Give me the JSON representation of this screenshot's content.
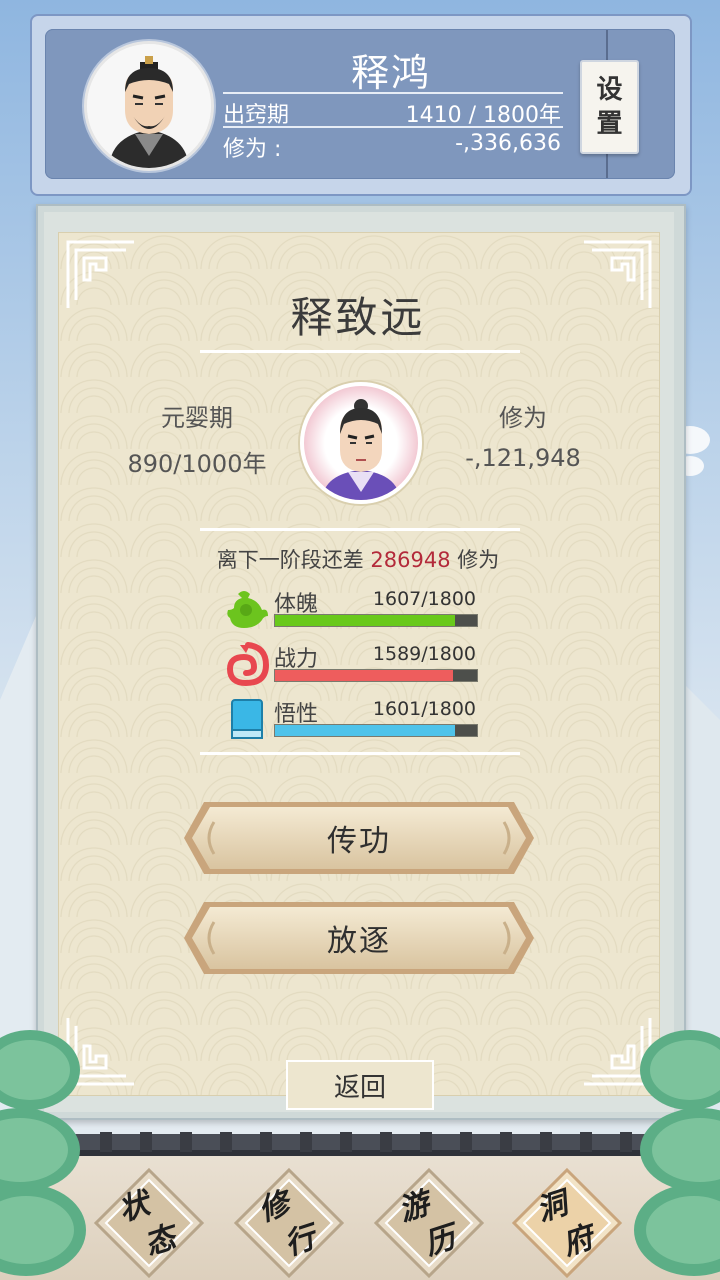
{
  "header": {
    "player_name": "释鸿",
    "realm_label": "出窍期",
    "realm_years": "1410 / 1800年",
    "cultivation_label": "修为 :",
    "cultivation_value": "-,336,636",
    "settings_char_1": "设",
    "settings_char_2": "置"
  },
  "character": {
    "name": "释致远",
    "realm": "元婴期",
    "realm_years": "890/1000年",
    "cultivation_label": "修为",
    "cultivation_value": "-,121,948",
    "next_stage_prefix": "离下一阶段还差",
    "next_stage_amount": "286948",
    "next_stage_suffix": "修为"
  },
  "attributes": [
    {
      "name": "体魄",
      "value": "1607/1800",
      "current": 1607,
      "max": 1800,
      "color": "#69c91b",
      "icon": "physique-icon"
    },
    {
      "name": "战力",
      "value": "1589/1800",
      "current": 1589,
      "max": 1800,
      "color": "#ee5d5d",
      "icon": "combat-icon"
    },
    {
      "name": "悟性",
      "value": "1601/1800",
      "current": 1601,
      "max": 1800,
      "color": "#4fc3ea",
      "icon": "book-icon"
    }
  ],
  "actions": {
    "transmit_label": "传功",
    "expel_label": "放逐",
    "back_label": "返回"
  },
  "nav": [
    {
      "c1": "状",
      "c2": "态"
    },
    {
      "c1": "修",
      "c2": "行"
    },
    {
      "c1": "游",
      "c2": "历"
    },
    {
      "c1": "洞",
      "c2": "府"
    }
  ]
}
